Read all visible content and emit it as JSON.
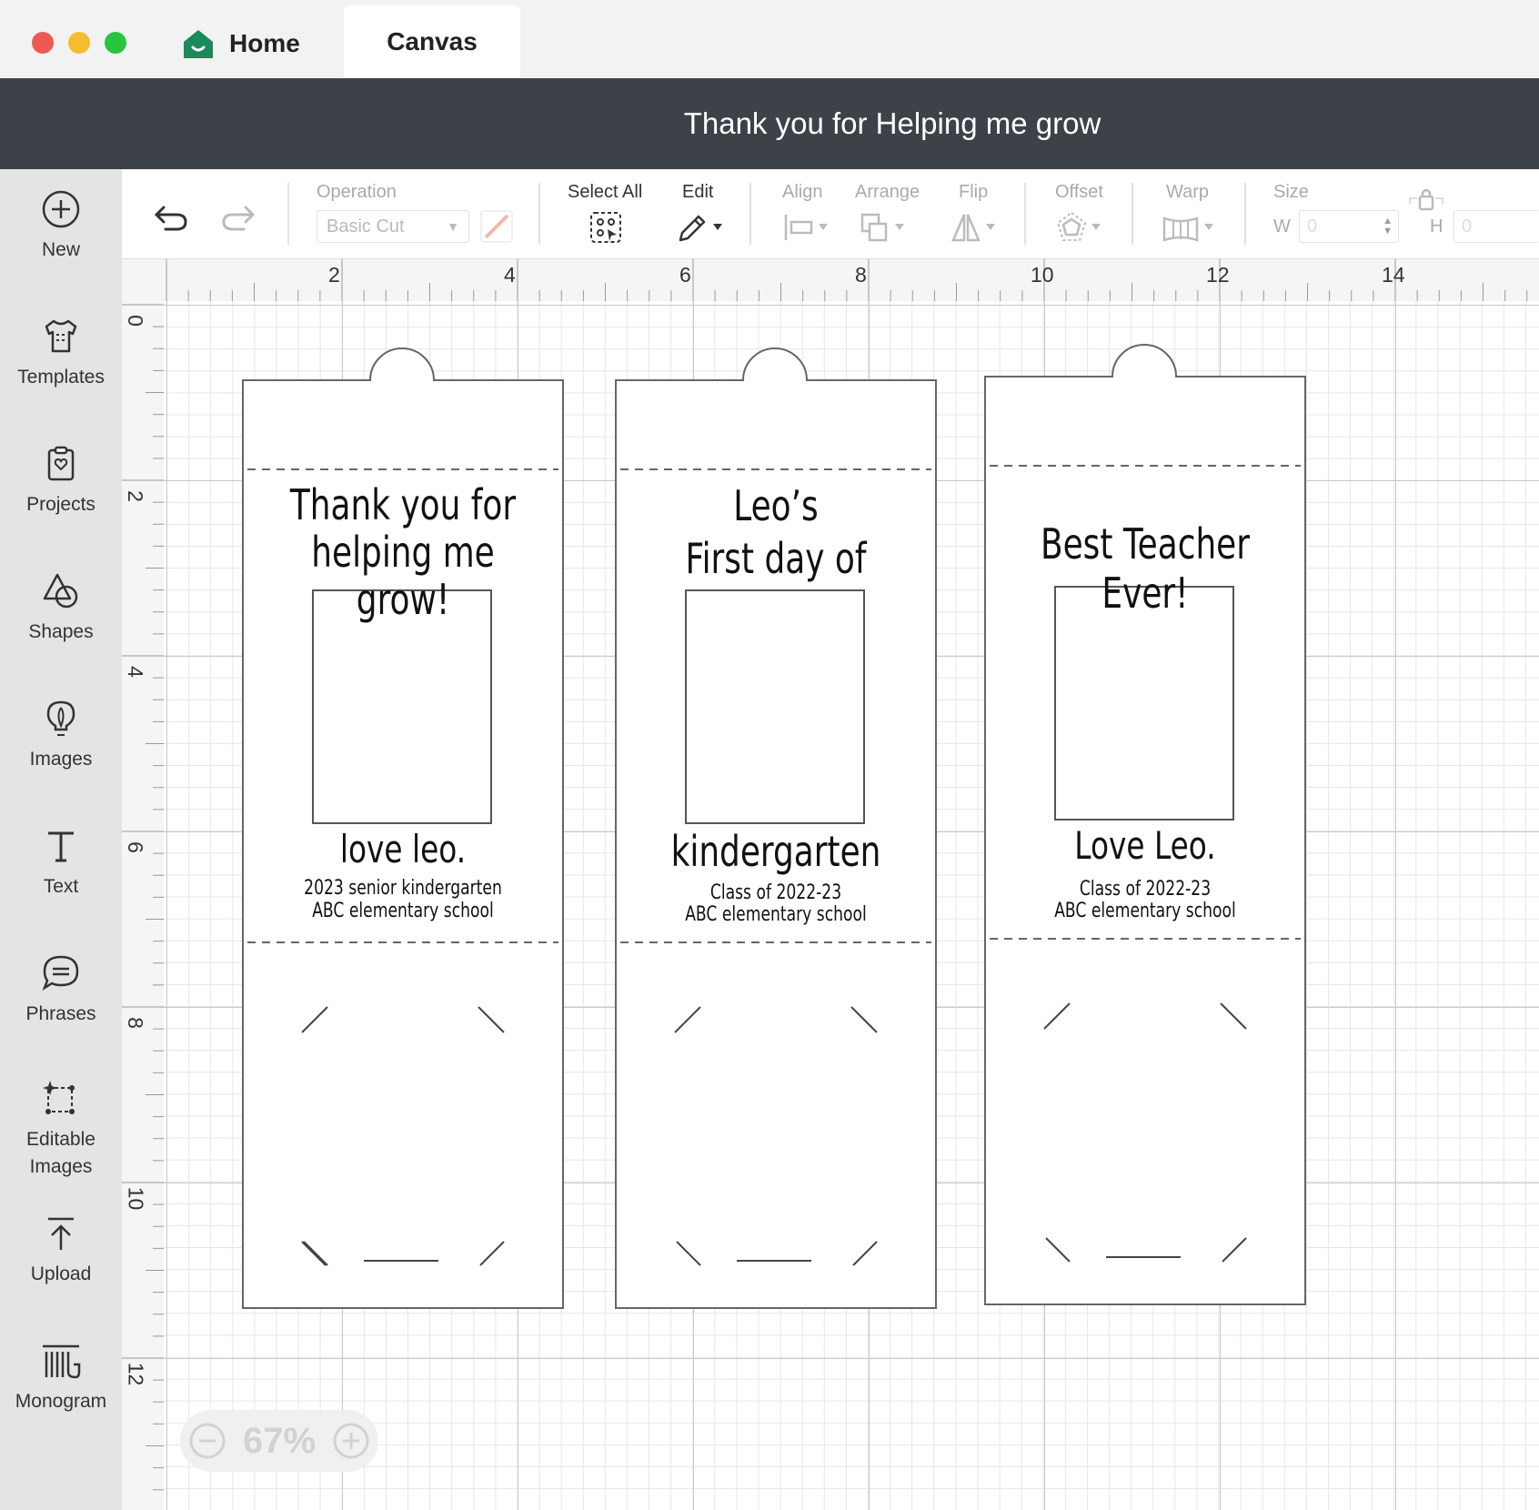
{
  "tabs": {
    "home": "Home",
    "canvas": "Canvas"
  },
  "project": {
    "title": "Thank you for Helping me grow"
  },
  "sidebar": {
    "items": [
      {
        "label": "New",
        "icon": "plus-circle-icon"
      },
      {
        "label": "Templates",
        "icon": "tshirt-icon"
      },
      {
        "label": "Projects",
        "icon": "clipboard-heart-icon"
      },
      {
        "label": "Shapes",
        "icon": "shapes-icon"
      },
      {
        "label": "Images",
        "icon": "lightbulb-icon"
      },
      {
        "label": "Text",
        "icon": "text-t-icon"
      },
      {
        "label": "Phrases",
        "icon": "speech-bubble-icon"
      },
      {
        "label": "Editable Images",
        "icon": "editable-image-icon"
      },
      {
        "label": "Upload",
        "icon": "upload-arrow-icon"
      },
      {
        "label": "Monogram",
        "icon": "monogram-icon"
      }
    ]
  },
  "toolbar": {
    "operation_label": "Operation",
    "operation_value": "Basic Cut",
    "select_all": "Select All",
    "edit": "Edit",
    "align": "Align",
    "arrange": "Arrange",
    "flip": "Flip",
    "offset": "Offset",
    "warp": "Warp",
    "size": "Size",
    "w_label": "W",
    "w_value": "0",
    "h_label": "H",
    "h_value": "0"
  },
  "rulers": {
    "top": [
      "2",
      "4",
      "6",
      "8",
      "10",
      "12",
      "14"
    ],
    "left": [
      "0",
      "2",
      "4",
      "6",
      "8",
      "10",
      "12"
    ]
  },
  "cards": [
    {
      "headline": "Thank you for\nhelping me grow!",
      "sign": "love leo.",
      "line1": "2023 senior kindergarten",
      "line2": "ABC elementary school"
    },
    {
      "headline": "Leo’s\nFirst day of",
      "sign": "kindergarten",
      "line1": "Class of 2022-23",
      "line2": "ABC elementary school"
    },
    {
      "headline": "Best Teacher Ever!",
      "sign": "Love Leo.",
      "line1": "Class of 2022-23",
      "line2": "ABC elementary school"
    }
  ],
  "zoom": {
    "level": "67%"
  },
  "colors": {
    "header_bg": "#3d4248",
    "brand_green": "#1a8a5b",
    "sidebar_bg": "#e4e4e4"
  }
}
